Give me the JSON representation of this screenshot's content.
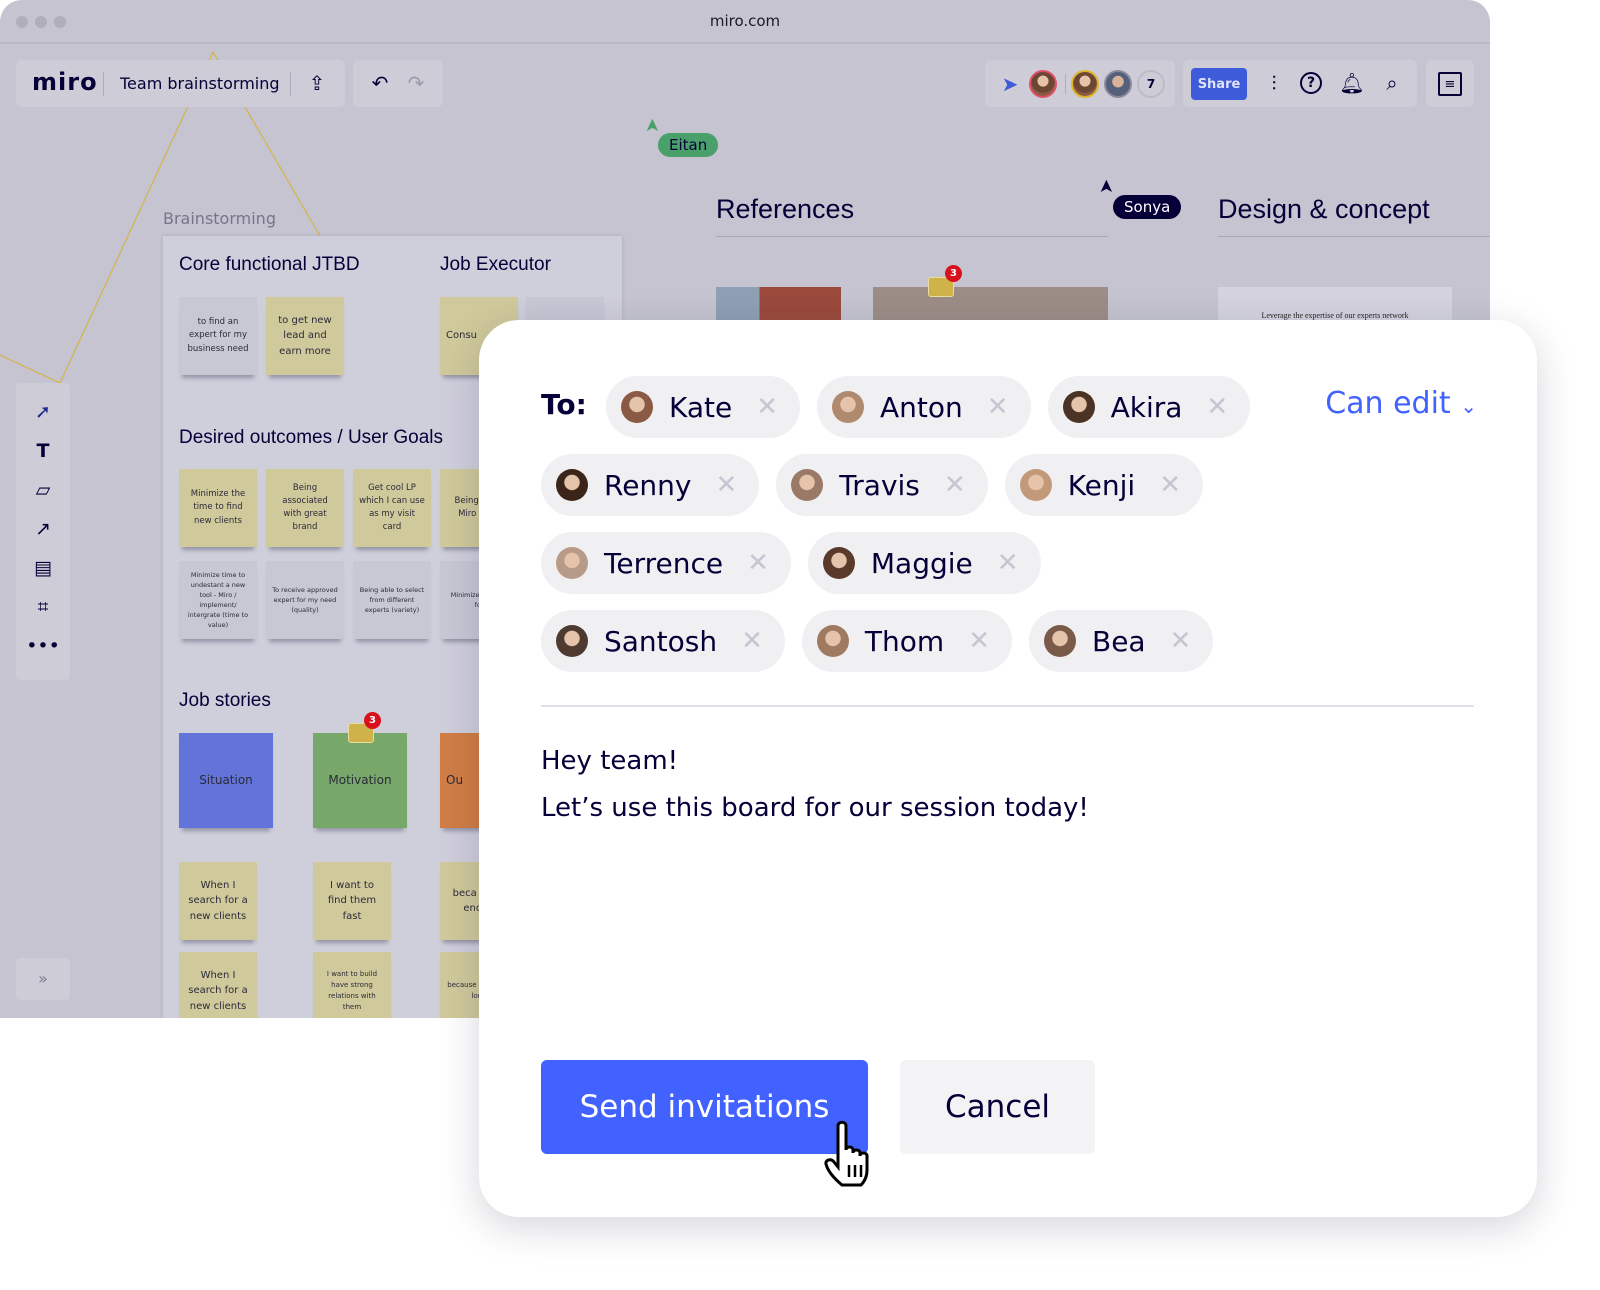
{
  "browser": {
    "url": "miro.com"
  },
  "topbar": {
    "logo": "miro",
    "board_title": "Team brainstorming",
    "collaborator_count": "7",
    "share_label": "Share",
    "accent": "#3e5bd9"
  },
  "cursors": [
    {
      "name": "Eitan",
      "color": "#4aa06a"
    },
    {
      "name": "Sonya",
      "color": "#050038"
    }
  ],
  "canvas": {
    "frame_label": "Brainstorming",
    "sections": {
      "references": "References",
      "design": "Design & concept",
      "design_thumb_text": "Leverage the expertise of our experts network"
    },
    "headings": {
      "core": "Core functional JTBD",
      "executor": "Job Executor",
      "outcomes": "Desired outcomes / User Goals",
      "stories": "Job stories"
    },
    "notes": {
      "core": [
        "to find an expert for my business need",
        "to get new lead and earn more"
      ],
      "executor": [
        "Consu"
      ],
      "outcomes_top": [
        "Minimize the time to find new clients",
        "Being associated with great brand",
        "Get cool LP which I can use as my visit card",
        "Being pr by Miro netw"
      ],
      "outcomes_bottom": [
        "Minimize time to undestant a new tool - Miro / implement/ intergrate (time to value)",
        "To receive approved expert for my need (quality)",
        "Being able to select from different experts (variety)",
        "Minimize t expert for"
      ],
      "story_headers": [
        "Situation",
        "Motivation",
        "Ou"
      ],
      "stories_row1": [
        "When I search for a new clients",
        "I want to find them fast",
        "beca don't enoug"
      ],
      "stories_row2": [
        "When I search for a new clients",
        "I want to build have strong relations with them",
        "because beneficia long"
      ]
    },
    "comment_badges": [
      "3",
      "3"
    ]
  },
  "dialog": {
    "to_label": "To:",
    "permission": "Can edit",
    "recipients": [
      "Kate",
      "Anton",
      "Akira",
      "Renny",
      "Travis",
      "Kenji",
      "Terrence",
      "Maggie",
      "Santosh",
      "Thom",
      "Bea"
    ],
    "message_line1": "Hey team!",
    "message_line2": "Let’s use this board for our session today!",
    "send_label": "Send invitations",
    "cancel_label": "Cancel",
    "accent": "#4262ff"
  }
}
